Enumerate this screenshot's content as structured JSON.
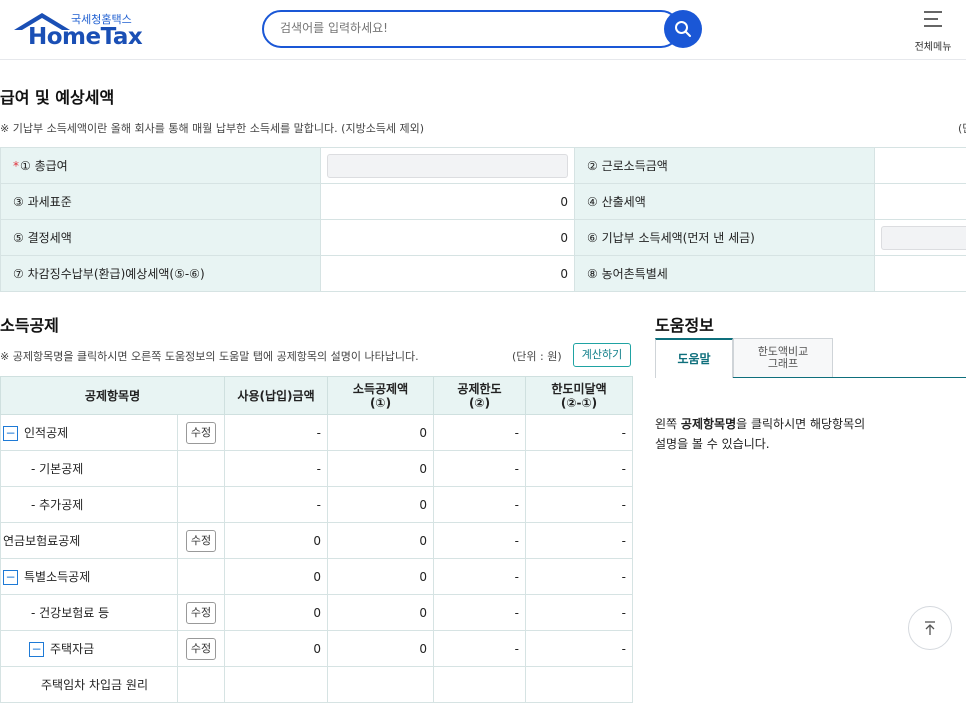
{
  "header": {
    "logo_sub": "국세청홈택스",
    "logo_main": "HomeTax",
    "search_placeholder": "검색어를 입력하세요!",
    "menu_label": "전체메뉴"
  },
  "summary": {
    "title": "급여 및 예상세액",
    "note": "※ 기납부 소득세액이란 올해 회사를 통해 매월 납부한 소득세를 말합니다. (지방소득세 제외)",
    "note_right": "(단",
    "rows": [
      {
        "l1": "① 총급여",
        "v1": "",
        "l2": "② 근로소득금액",
        "v2": ""
      },
      {
        "l1": "③ 과세표준",
        "v1": "0",
        "l2": "④ 산출세액",
        "v2": ""
      },
      {
        "l1": "⑤ 결정세액",
        "v1": "0",
        "l2": "⑥ 기납부 소득세액(먼저 낸 세금)",
        "v2": ""
      },
      {
        "l1": "⑦ 차감징수납부(환급)예상세액(⑤-⑥)",
        "v1": "0",
        "l2": "⑧ 농어촌특별세",
        "v2": ""
      }
    ]
  },
  "deduction": {
    "title": "소득공제",
    "note": "※ 공제항목명을 클릭하시면 오른쪽 도움정보의 도움말 탭에 공제항목의 설명이 나타납니다.",
    "unit": "(단위 : 원)",
    "calc_button": "계산하기",
    "columns": {
      "name": "공제항목명",
      "used": "사용(납입)금액",
      "amount_l1": "소득공제액",
      "amount_l2": "(①)",
      "limit_l1": "공제한도",
      "limit_l2": "(②)",
      "rest_l1": "한도미달액",
      "rest_l2": "(②-①)"
    },
    "edit_label": "수정",
    "rows": [
      {
        "name": "인적공제",
        "used": "-",
        "amount": "0",
        "limit": "-",
        "rest": "-"
      },
      {
        "name": "- 기본공제",
        "used": "-",
        "amount": "0",
        "limit": "-",
        "rest": "-"
      },
      {
        "name": "- 추가공제",
        "used": "-",
        "amount": "0",
        "limit": "-",
        "rest": "-"
      },
      {
        "name": "연금보험료공제",
        "used": "0",
        "amount": "0",
        "limit": "-",
        "rest": "-"
      },
      {
        "name": "특별소득공제",
        "used": "0",
        "amount": "0",
        "limit": "-",
        "rest": "-"
      },
      {
        "name": "- 건강보험료 등",
        "used": "0",
        "amount": "0",
        "limit": "-",
        "rest": "-"
      },
      {
        "name": "주택자금",
        "used": "0",
        "amount": "0",
        "limit": "-",
        "rest": "-"
      },
      {
        "name": "주택임차 차입금 원리",
        "used": "",
        "amount": "",
        "limit": "",
        "rest": ""
      }
    ]
  },
  "help": {
    "title": "도움정보",
    "tab_help": "도움말",
    "tab_graph_l1": "한도액비교",
    "tab_graph_l2": "그래프",
    "text_pre": "왼쪽 ",
    "text_bold": "공제항목명",
    "text_post": "을 클릭하시면 해당항목의",
    "text_line2": "설명을 볼 수 있습니다."
  },
  "colors": {
    "brand": "#1a57d6",
    "teal": "#0e6f7c",
    "cell_bg": "#e8f4f3"
  }
}
